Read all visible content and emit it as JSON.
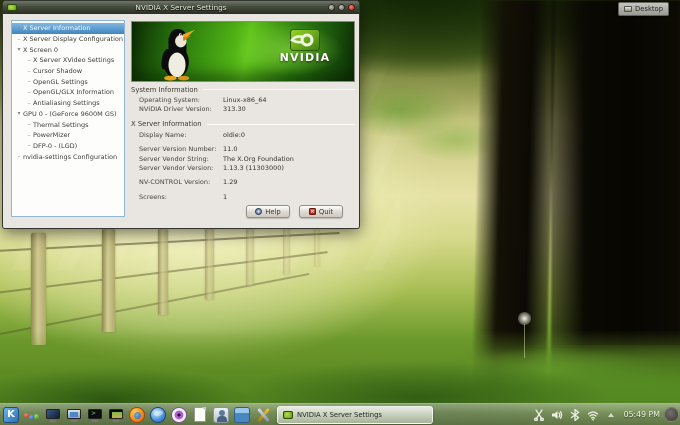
{
  "desktop": {
    "desktop_button_label": "Desktop"
  },
  "window": {
    "title": "NVIDIA X Server Settings",
    "window_icon": "nvidia-icon",
    "sidebar_items": [
      {
        "label": "X Server Information",
        "level": 0,
        "marker": "none",
        "selected": true
      },
      {
        "label": "X Server Display Configuration",
        "level": 0,
        "marker": "dash",
        "selected": false
      },
      {
        "label": "X Screen 0",
        "level": 0,
        "marker": "expanded",
        "selected": false
      },
      {
        "label": "X Server XVideo Settings",
        "level": 1,
        "marker": "dash",
        "selected": false
      },
      {
        "label": "Cursor Shadow",
        "level": 1,
        "marker": "dash",
        "selected": false
      },
      {
        "label": "OpenGL Settings",
        "level": 1,
        "marker": "dash",
        "selected": false
      },
      {
        "label": "OpenGL/GLX Information",
        "level": 1,
        "marker": "dash",
        "selected": false
      },
      {
        "label": "Antialiasing Settings",
        "level": 1,
        "marker": "dash",
        "selected": false
      },
      {
        "label": "GPU 0 - (GeForce 9600M GS)",
        "level": 0,
        "marker": "expanded",
        "selected": false
      },
      {
        "label": "Thermal Settings",
        "level": 1,
        "marker": "dash",
        "selected": false
      },
      {
        "label": "PowerMizer",
        "level": 1,
        "marker": "dash",
        "selected": false
      },
      {
        "label": "DFP-0 - (LGD)",
        "level": 1,
        "marker": "dash",
        "selected": false
      },
      {
        "label": "nvidia-settings Configuration",
        "level": 0,
        "marker": "dash",
        "selected": false
      }
    ],
    "banner_brand": "NVIDIA",
    "sections": [
      {
        "title": "System Information",
        "groups": [
          [
            {
              "label": "Operating System:",
              "value": "Linux-x86_64"
            },
            {
              "label": "NVIDIA Driver Version:",
              "value": "313.30"
            }
          ]
        ]
      },
      {
        "title": "X Server Information",
        "groups": [
          [
            {
              "label": "Display Name:",
              "value": "oldie:0"
            }
          ],
          [
            {
              "label": "Server Version Number:",
              "value": "11.0"
            },
            {
              "label": "Server Vendor String:",
              "value": "The X.Org Foundation"
            },
            {
              "label": "Server Vendor Version:",
              "value": "1.13.3 (11303000)"
            }
          ],
          [
            {
              "label": "NV-CONTROL Version:",
              "value": "1.29"
            }
          ],
          [
            {
              "label": "Screens:",
              "value": "1"
            }
          ]
        ]
      }
    ],
    "help_label": "Help",
    "quit_label": "Quit"
  },
  "taskbar": {
    "launchers": [
      "kde-menu",
      "colored-dots",
      "monitor",
      "computer",
      "terminal",
      "media-display",
      "firefox",
      "konqueror",
      "eye",
      "document",
      "user",
      "package",
      "tools"
    ],
    "task_button_label": "NVIDIA X Server Settings",
    "tray_icons": [
      "klipper-scissors",
      "volume",
      "bluetooth",
      "wifi",
      "tray-expander"
    ],
    "clock": "05:49 PM"
  },
  "colors": {
    "nvidia_green": "#77b900",
    "selection_blue": "#4086c1",
    "close_red": "#ae3124",
    "banner_green_bright": "#63c51d",
    "fog_yellow": "#e6e2a6"
  }
}
